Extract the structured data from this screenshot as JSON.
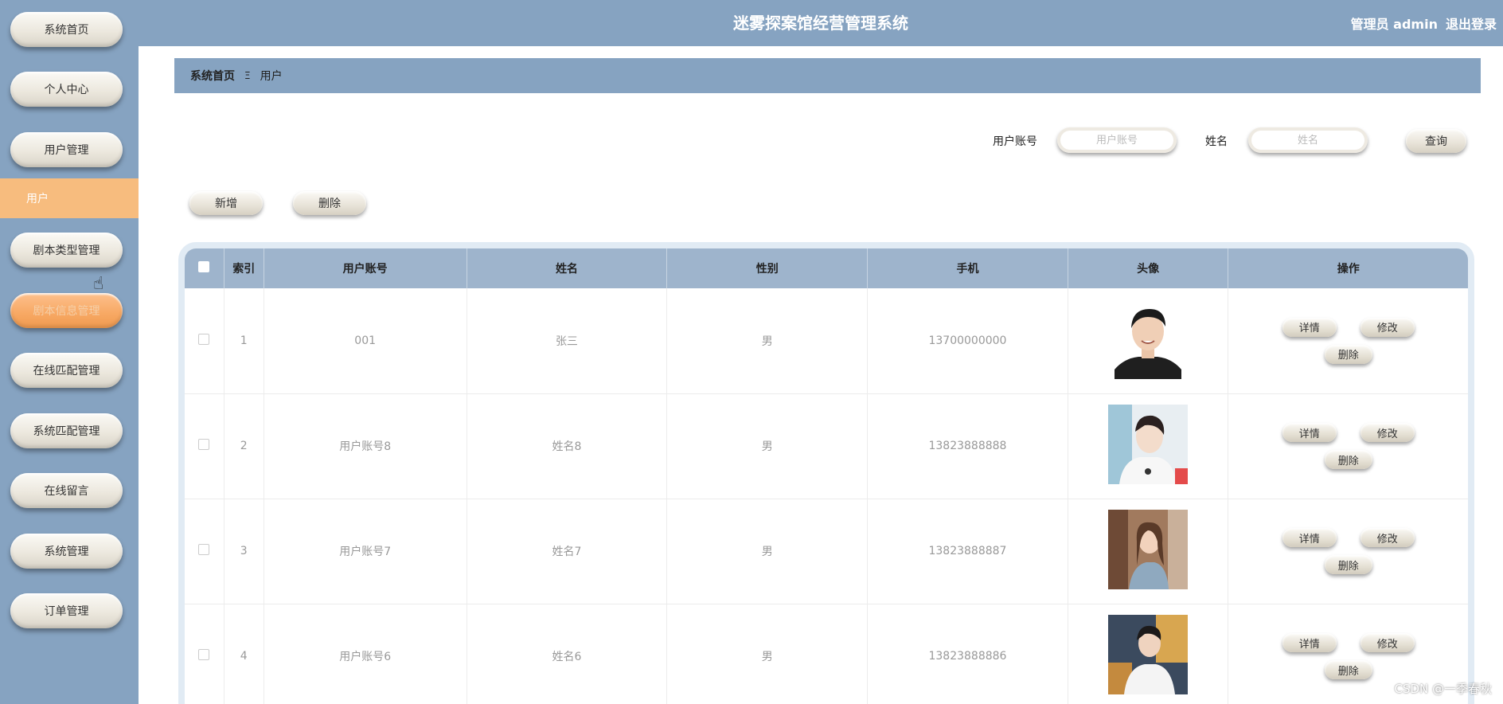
{
  "app": {
    "title": "迷雾探案馆经营管理系统",
    "user_label": "管理员 admin",
    "logout": "退出登录"
  },
  "sidebar": {
    "items": [
      {
        "label": "系统首页"
      },
      {
        "label": "个人中心"
      },
      {
        "label": "用户管理"
      },
      {
        "label": "用户"
      },
      {
        "label": "剧本类型管理"
      },
      {
        "label": "剧本信息管理"
      },
      {
        "label": "在线匹配管理"
      },
      {
        "label": "系统匹配管理"
      },
      {
        "label": "在线留言"
      },
      {
        "label": "系统管理"
      },
      {
        "label": "订单管理"
      }
    ]
  },
  "breadcrumb": {
    "home": "系统首页",
    "separator": "Ξ",
    "current": "用户"
  },
  "search": {
    "account_label": "用户账号",
    "account_placeholder": "用户账号",
    "name_label": "姓名",
    "name_placeholder": "姓名",
    "query_button": "查询"
  },
  "actions": {
    "add": "新增",
    "delete": "删除"
  },
  "table": {
    "headers": [
      "索引",
      "用户账号",
      "姓名",
      "性别",
      "手机",
      "头像",
      "操作"
    ],
    "rows": [
      {
        "index": "1",
        "account": "001",
        "name": "张三",
        "gender": "男",
        "phone": "13700000000"
      },
      {
        "index": "2",
        "account": "用户账号8",
        "name": "姓名8",
        "gender": "男",
        "phone": "13823888888"
      },
      {
        "index": "3",
        "account": "用户账号7",
        "name": "姓名7",
        "gender": "男",
        "phone": "13823888887"
      },
      {
        "index": "4",
        "account": "用户账号6",
        "name": "姓名6",
        "gender": "男",
        "phone": "13823888886"
      }
    ],
    "ops": {
      "detail": "详情",
      "edit": "修改",
      "delete": "删除"
    }
  },
  "watermark": "CSDN @一季春秋",
  "colors": {
    "header": "#86a3c1",
    "table_head": "#9eb4cc",
    "active_menu": "#f7bc7e",
    "orange_pill": "#f7a863"
  }
}
